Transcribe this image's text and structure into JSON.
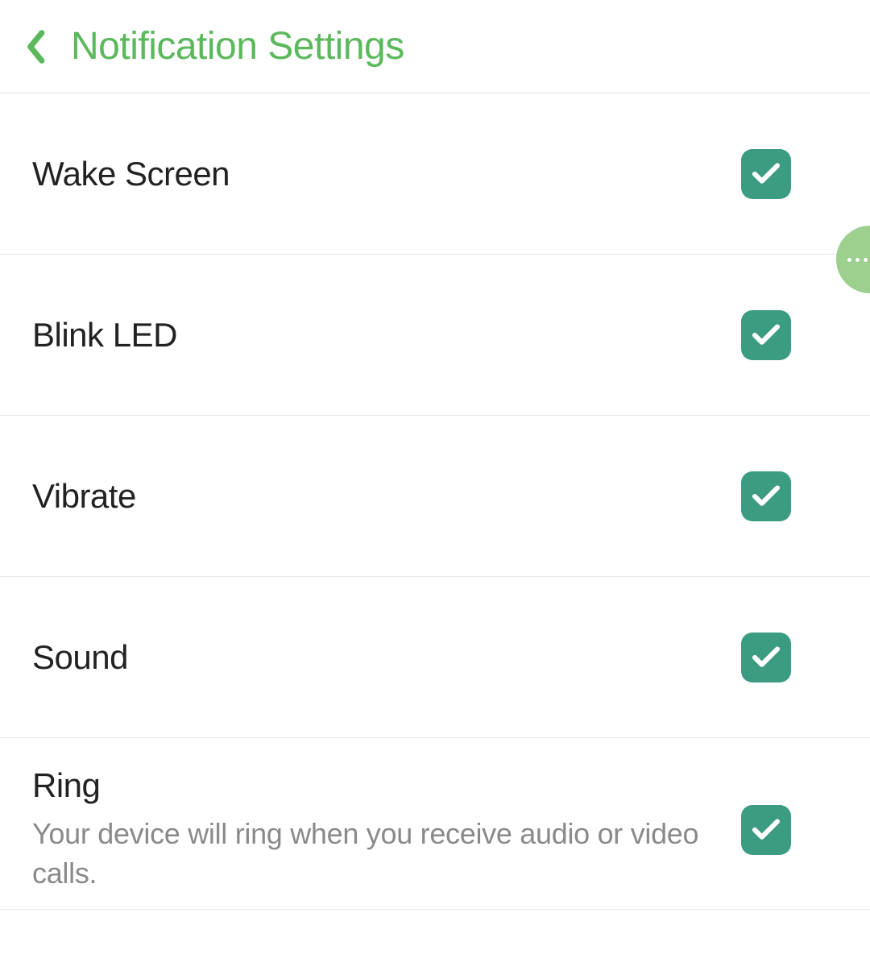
{
  "header": {
    "title": "Notification Settings"
  },
  "settings": [
    {
      "label": "Wake Screen",
      "subtitle": null,
      "checked": true
    },
    {
      "label": "Blink LED",
      "subtitle": null,
      "checked": true
    },
    {
      "label": "Vibrate",
      "subtitle": null,
      "checked": true
    },
    {
      "label": "Sound",
      "subtitle": null,
      "checked": true
    },
    {
      "label": "Ring",
      "subtitle": "Your device will ring when you receive audio or video calls.",
      "checked": true
    }
  ],
  "colors": {
    "accent": "#5bb85c",
    "checkbox": "#3b9c82",
    "floating": "#9dcf8f"
  }
}
